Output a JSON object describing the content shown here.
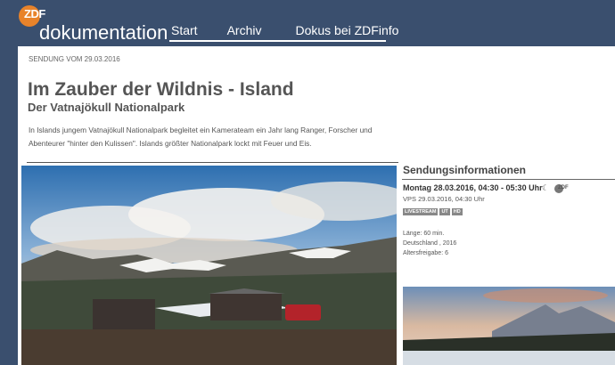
{
  "header": {
    "logo_text": "ZDF",
    "brand": "dokumentation",
    "nav": [
      {
        "label": "Start"
      },
      {
        "label": "Archiv"
      },
      {
        "label": "Dokus bei ZDFinfo"
      }
    ]
  },
  "article": {
    "meta": "SENDUNG VOM 29.03.2016",
    "title": "Im Zauber der Wildnis - Island",
    "subtitle": "Der Vatnajökull Nationalpark",
    "description": "In Islands jungem Vatnajökull Nationalpark begleitet ein Kamerateam ein Jahr lang Ranger, Forscher und Abenteurer \"hinter den Kulissen\". Islands größter Nationalpark lockt mit Feuer und Eis."
  },
  "sidebar": {
    "title": "Sendungsinformationen",
    "airdate": "Montag 28.03.2016, 04:30 - 05:30 Uhr",
    "moon_icon": "☾",
    "channel_logo": "ZDF",
    "vps": "VPS 29.03.2016, 04:30 Uhr",
    "badges": [
      "LIVESTREAM",
      "UT",
      "HD"
    ],
    "info": {
      "length": "Länge: 60 min.",
      "country": "Deutschland , 2016",
      "age": "Altersfreigabe: 6"
    }
  },
  "colors": {
    "header_bg": "#3a4f6e",
    "logo_orange": "#e8832a",
    "text_gray": "#555555"
  }
}
